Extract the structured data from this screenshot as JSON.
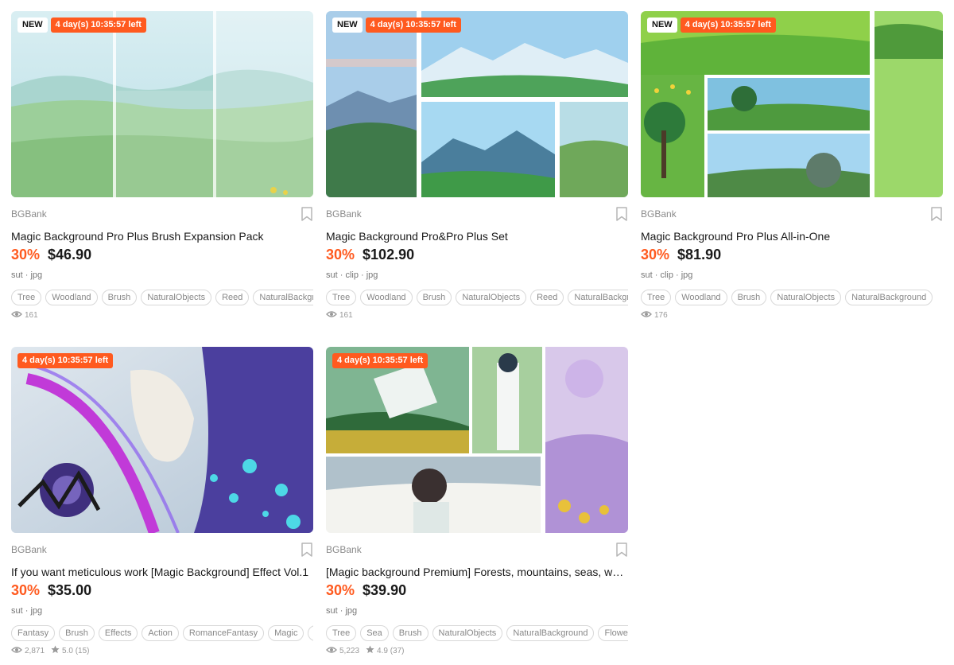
{
  "colors": {
    "accent": "#ff5a1f",
    "text": "#1a1a1a",
    "muted": "#8a8a8a"
  },
  "products": [
    {
      "new_badge": "NEW",
      "timer": "4 day(s) 10:35:57 left",
      "seller": "BGBank",
      "title": "Magic Background Pro Plus Brush Expansion Pack",
      "discount": "30%",
      "price": "$46.90",
      "formats": "sut · jpg",
      "tags": [
        "Tree",
        "Woodland",
        "Brush",
        "NaturalObjects",
        "Reed",
        "NaturalBackground"
      ],
      "views": "161",
      "rating": null,
      "thumb_theme": "meadow-pale"
    },
    {
      "new_badge": "NEW",
      "timer": "4 day(s) 10:35:57 left",
      "seller": "BGBank",
      "title": "Magic Background Pro&Pro Plus Set",
      "discount": "30%",
      "price": "$102.90",
      "formats": "sut · clip · jpg",
      "tags": [
        "Tree",
        "Woodland",
        "Brush",
        "NaturalObjects",
        "Reed",
        "NaturalBackground"
      ],
      "views": "161",
      "rating": null,
      "thumb_theme": "mountains"
    },
    {
      "new_badge": "NEW",
      "timer": "4 day(s) 10:35:57 left",
      "seller": "BGBank",
      "title": "Magic Background Pro Plus All-in-One",
      "discount": "30%",
      "price": "$81.90",
      "formats": "sut · clip · jpg",
      "tags": [
        "Tree",
        "Woodland",
        "Brush",
        "NaturalObjects",
        "NaturalBackground"
      ],
      "views": "176",
      "rating": null,
      "thumb_theme": "meadow-vivid"
    },
    {
      "new_badge": null,
      "timer": "4 day(s) 10:35:57 left",
      "seller": "BGBank",
      "title": "If you want meticulous work [Magic Background] Effect Vol.1",
      "discount": "30%",
      "price": "$35.00",
      "formats": "sut · jpg",
      "tags": [
        "Fantasy",
        "Brush",
        "Effects",
        "Action",
        "RomanceFantasy",
        "Magic",
        "Light"
      ],
      "views": "2,871",
      "rating": "5.0 (15)",
      "thumb_theme": "effects"
    },
    {
      "new_badge": null,
      "timer": "4 day(s) 10:35:57 left",
      "seller": "BGBank",
      "title": "[Magic background Premium] Forests, mountains, seas, waterfalls",
      "discount": "30%",
      "price": "$39.90",
      "formats": "sut · jpg",
      "tags": [
        "Tree",
        "Sea",
        "Brush",
        "NaturalObjects",
        "NaturalBackground",
        "Flower"
      ],
      "views": "5,223",
      "rating": "4.9 (37)",
      "thumb_theme": "comic"
    }
  ]
}
